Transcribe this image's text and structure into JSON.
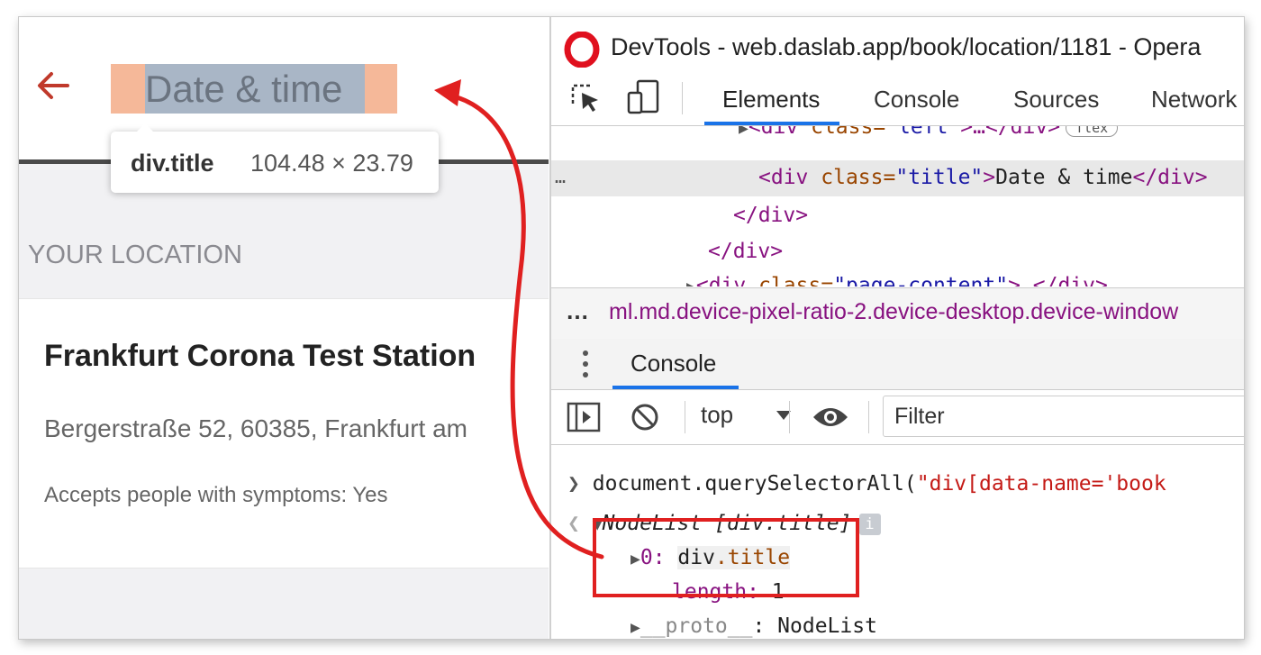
{
  "app": {
    "header_title": "Date & time",
    "tooltip": {
      "tag": "div.title",
      "size": "104.48 × 23.79"
    },
    "section_label": "YOUR LOCATION",
    "location": {
      "name": "Frankfurt Corona Test Station",
      "address": "Bergerstraße 52, 60385, Frankfurt am",
      "symptoms": "Accepts people with symptoms: Yes"
    }
  },
  "devtools": {
    "window_title": "DevTools - web.daslab.app/book/location/1181 - Opera",
    "tabs": [
      "Elements",
      "Console",
      "Sources",
      "Network"
    ],
    "active_tab": "Elements",
    "dom": {
      "line1": {
        "open": "<div ",
        "attr": "class=",
        "val": "\"left\"",
        "rest": ">…</div>",
        "badge": "flex"
      },
      "line2": {
        "open": "<div ",
        "attr": "class=",
        "val": "\"title\"",
        "mid": ">",
        "text": "Date & time",
        "close": "</div>"
      },
      "line3": "</div>",
      "line4": "</div>",
      "line5": {
        "open": "<div ",
        "attr": "class=",
        "val": "\"page-content\"",
        "rest": ">…</div>"
      },
      "dots": "…"
    },
    "breadcrumb": {
      "dots": "…",
      "text": "ml.md.device-pixel-ratio-2.device-desktop.device-window"
    },
    "drawer_tab": "Console",
    "console_toolbar": {
      "context": "top",
      "filter_placeholder": "Filter"
    },
    "console": {
      "command_prefix": "document.querySelectorAll(",
      "command_string": "\"div[data-name='book",
      "result_label": "NodeList [div.title]",
      "info_badge": "i",
      "item0_key": "0:",
      "item0_tag": "div",
      "item0_cls": ".title",
      "length_key": "length:",
      "length_val": "1",
      "proto_key": "__proto__",
      "proto_val": ": NodeList"
    }
  },
  "colors": {
    "accent_red": "#e02020",
    "title_padding": "#f5b899",
    "title_content": "#a9b6c6",
    "devtools_blue": "#1a73e8"
  }
}
